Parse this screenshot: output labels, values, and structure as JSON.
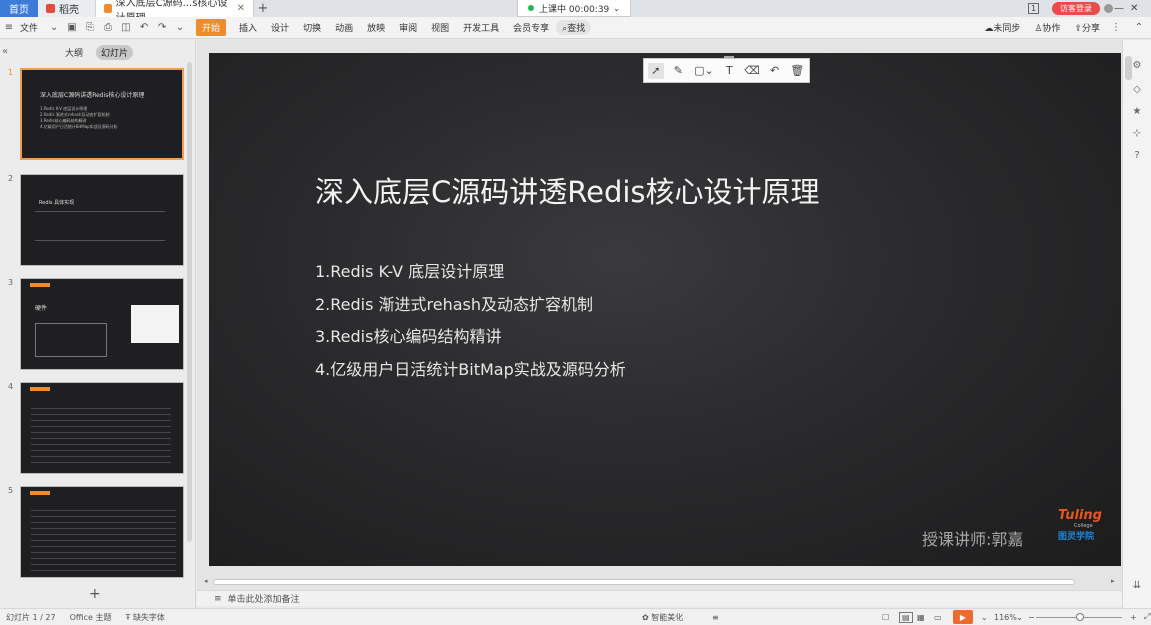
{
  "titlebar": {
    "home_tab": "首页",
    "doc_tab": "稻壳",
    "active_tab": "深入底层C源码...s核心设计原理",
    "new_tab": "+",
    "session_label": "上课中 00:00:39",
    "page_count": "1",
    "login_label": "访客登录"
  },
  "ribbon": {
    "file_menu": "文件",
    "tabs": [
      "开始",
      "插入",
      "设计",
      "切换",
      "动画",
      "放映",
      "审阅",
      "视图",
      "开发工具",
      "会员专享"
    ],
    "search_label": "查找",
    "sync_label": "未同步",
    "collab_label": "协作",
    "share_label": "分享"
  },
  "left_panel": {
    "tab_outline": "大纲",
    "tab_slides": "幻灯片",
    "slide_numbers": [
      "1",
      "2",
      "3",
      "4",
      "5"
    ],
    "thumb1_title": "深入底层C源码讲透Redis核心设计原理",
    "thumb1_lines": [
      "1.Redis K-V 底层设计原理",
      "2.Redis 渐进式rehash及动态扩容机制",
      "3.Redis核心编码结构精讲",
      "4.亿级用户日活统计BitMap实战及源码分析"
    ],
    "thumb2_title": "Redis 具体实现",
    "thumb3_title": "硬件",
    "add_slide": "+"
  },
  "slide": {
    "title": "深入底层C源码讲透Redis核心设计原理",
    "items": [
      "1.Redis K-V 底层设计原理",
      "2.Redis 渐进式rehash及动态扩容机制",
      "3.Redis核心编码结构精讲",
      "4.亿级用户日活统计BitMap实战及源码分析"
    ],
    "lecturer": "授课讲师:郭嘉",
    "logo_text": "Tuling",
    "logo_sub": "College",
    "logo_cn": "图灵学院"
  },
  "notes": {
    "placeholder": "单击此处添加备注"
  },
  "statusbar": {
    "slide_info": "幻灯片 1 / 27",
    "theme": "Office 主题",
    "missing_font": "缺失字体",
    "smart_beautify": "智能美化",
    "zoom": "116%",
    "zoom_minus": "−",
    "zoom_plus": "+"
  },
  "colors": {
    "accent_orange": "#f08c2c",
    "home_blue": "#3d7bd9",
    "slide_bg": "#2a2a2c"
  }
}
